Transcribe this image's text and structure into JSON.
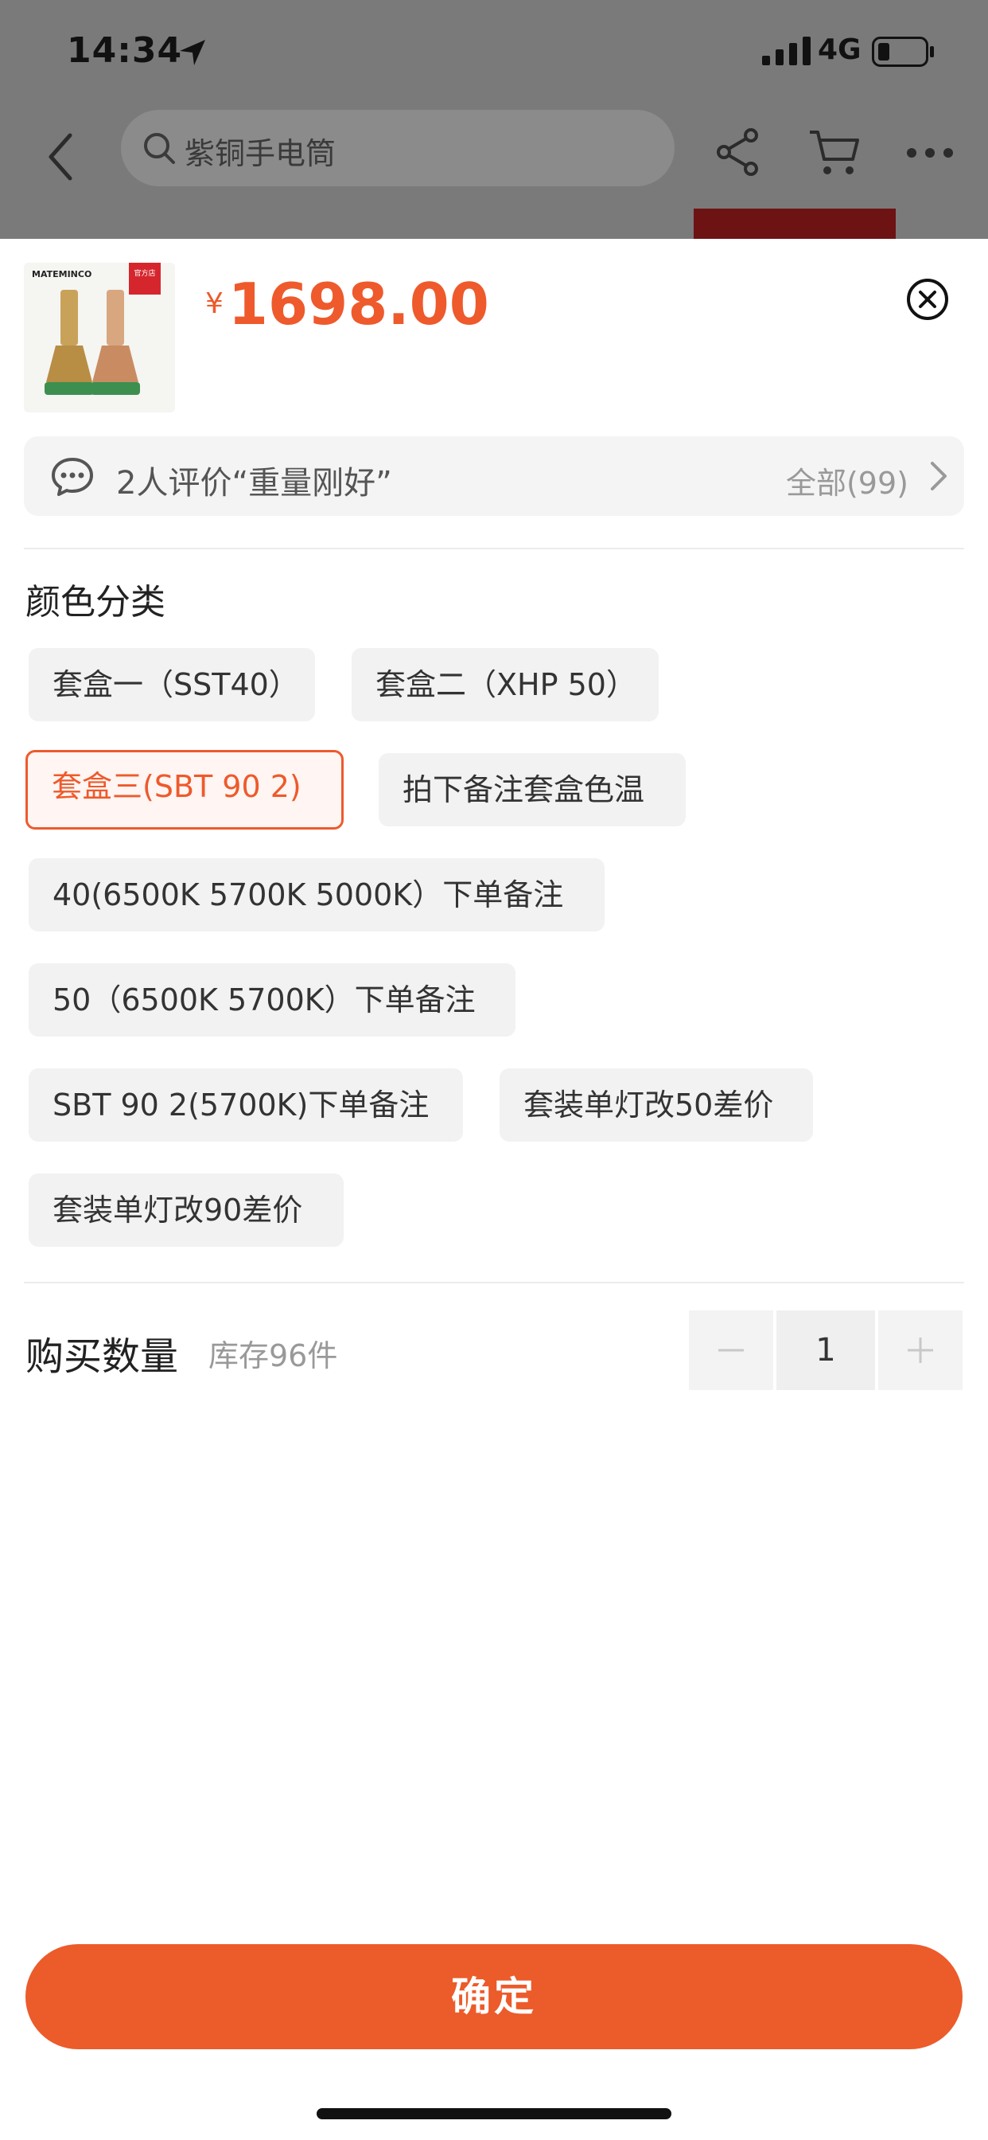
{
  "status_bar": {
    "time": "14:34",
    "network": "4G"
  },
  "navbar": {
    "search_text": "紫铜手电筒"
  },
  "product": {
    "currency": "¥",
    "price": "1698.00",
    "thumb_brand": "MATEMINCO",
    "thumb_badge": "官方店"
  },
  "review": {
    "text": "2人评价“重量刚好”",
    "all": "全部(99)"
  },
  "sku": {
    "title": "颜色分类",
    "options": [
      {
        "label": "套盒一（SST40）",
        "selected": false
      },
      {
        "label": "套盒二（XHP  50）",
        "selected": false
      },
      {
        "label": "套盒三(SBT  90 2)",
        "selected": true
      },
      {
        "label": "拍下备注套盒色温",
        "selected": false
      },
      {
        "label": "40(6500K 5700K 5000K）下单备注",
        "selected": false
      },
      {
        "label": "50（6500K 5700K）下单备注",
        "selected": false
      },
      {
        "label": "SBT 90 2(5700K)下单备注",
        "selected": false
      },
      {
        "label": "套装单灯改50差价",
        "selected": false
      },
      {
        "label": "套装单灯改90差价",
        "selected": false
      }
    ]
  },
  "quantity": {
    "label": "购买数量",
    "stock": "库存96件",
    "value": "1"
  },
  "confirm_label": "确定",
  "colors": {
    "accent": "#ee5a2c",
    "button": "#ec5b2a"
  }
}
